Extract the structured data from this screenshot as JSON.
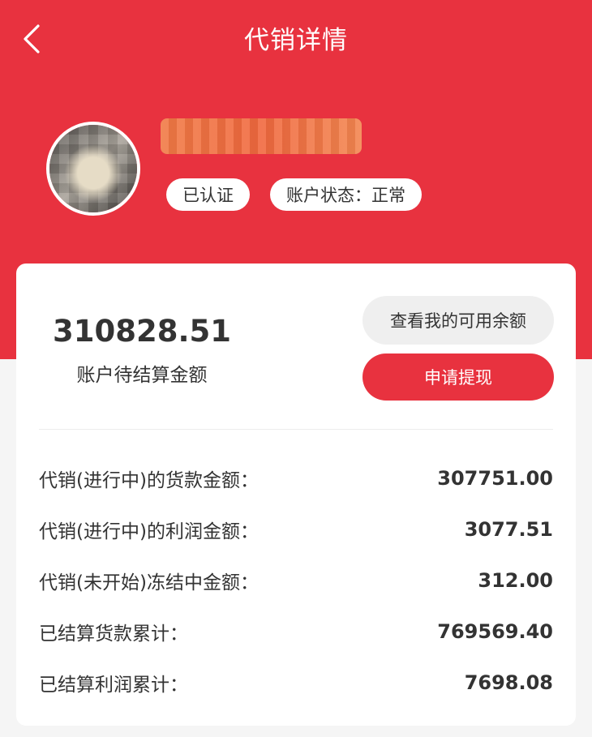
{
  "header": {
    "title": "代销详情",
    "back_icon": "chevron-left-icon",
    "background_color": "#e8323f"
  },
  "profile": {
    "badges": {
      "verified": "已认证",
      "account_status": "账户状态：正常"
    }
  },
  "summary": {
    "pending_amount": "310828.51",
    "pending_label": "账户待结算金额",
    "available_button": "查看我的可用余额",
    "withdraw_button": "申请提现"
  },
  "details": [
    {
      "label": "代销(进行中)的货款金额：",
      "value": "307751.00"
    },
    {
      "label": "代销(进行中)的利润金额：",
      "value": "3077.51"
    },
    {
      "label": "代销(未开始)冻结中金额：",
      "value": "312.00"
    },
    {
      "label": "已结算货款累计：",
      "value": "769569.40"
    },
    {
      "label": "已结算利润累计：",
      "value": "7698.08"
    }
  ]
}
